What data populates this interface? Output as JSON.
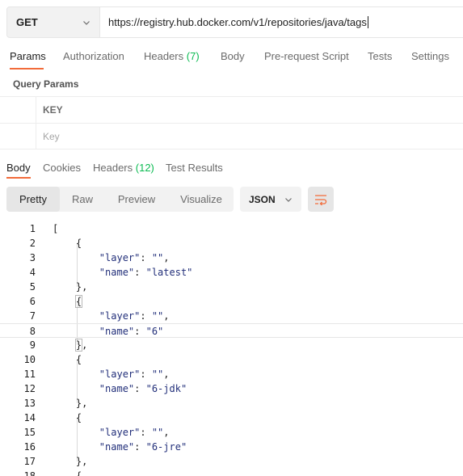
{
  "request": {
    "method": "GET",
    "url": "https://registry.hub.docker.com/v1/repositories/java/tags"
  },
  "request_tabs": [
    {
      "label": "Params",
      "active": true
    },
    {
      "label": "Authorization"
    },
    {
      "label": "Headers",
      "count": "(7)"
    },
    {
      "label": "Body"
    },
    {
      "label": "Pre-request Script"
    },
    {
      "label": "Tests"
    },
    {
      "label": "Settings"
    }
  ],
  "query_params": {
    "title": "Query Params",
    "column_key": "KEY",
    "key_placeholder": "Key"
  },
  "response_tabs": [
    {
      "label": "Body",
      "active": true
    },
    {
      "label": "Cookies"
    },
    {
      "label": "Headers",
      "count": "(12)"
    },
    {
      "label": "Test Results"
    }
  ],
  "view_modes": [
    "Pretty",
    "Raw",
    "Preview",
    "Visualize"
  ],
  "active_view": "Pretty",
  "format": "JSON",
  "colors": {
    "accent": "#f26b3a",
    "count_green": "#0cbb52",
    "json_token": "#222f7a"
  },
  "code_lines": [
    {
      "n": "1",
      "text": "["
    },
    {
      "n": "2",
      "text": "    {"
    },
    {
      "n": "3",
      "key": "\"layer\"",
      "value": "\"\"",
      "trail": ",",
      "indent": "        "
    },
    {
      "n": "4",
      "key": "\"name\"",
      "value": "\"latest\"",
      "trail": "",
      "indent": "        "
    },
    {
      "n": "5",
      "text": "    },"
    },
    {
      "n": "6",
      "text": "    {"
    },
    {
      "n": "7",
      "key": "\"layer\"",
      "value": "\"\"",
      "trail": ",",
      "indent": "        "
    },
    {
      "n": "8",
      "key": "\"name\"",
      "value": "\"6\"",
      "trail": "",
      "indent": "        "
    },
    {
      "n": "9",
      "text": "    },"
    },
    {
      "n": "10",
      "text": "    {"
    },
    {
      "n": "11",
      "key": "\"layer\"",
      "value": "\"\"",
      "trail": ",",
      "indent": "        "
    },
    {
      "n": "12",
      "key": "\"name\"",
      "value": "\"6-jdk\"",
      "trail": "",
      "indent": "        "
    },
    {
      "n": "13",
      "text": "    },"
    },
    {
      "n": "14",
      "text": "    {"
    },
    {
      "n": "15",
      "key": "\"layer\"",
      "value": "\"\"",
      "trail": ",",
      "indent": "        "
    },
    {
      "n": "16",
      "key": "\"name\"",
      "value": "\"6-jre\"",
      "trail": "",
      "indent": "        "
    },
    {
      "n": "17",
      "text": "    },"
    },
    {
      "n": "18",
      "text": "    {"
    }
  ]
}
